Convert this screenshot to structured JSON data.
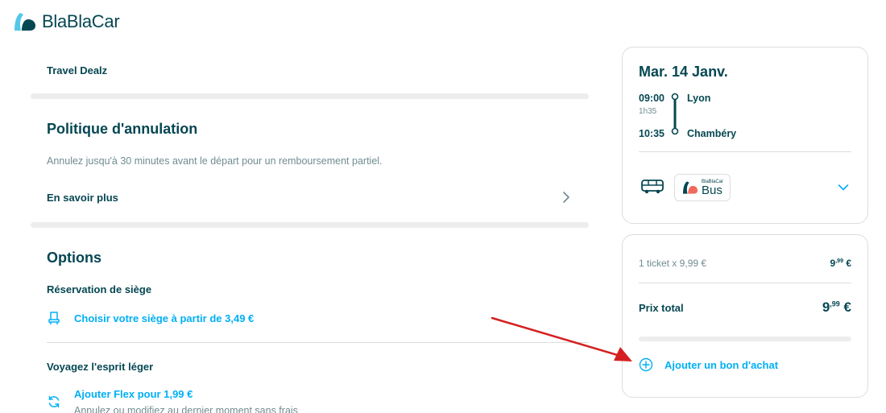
{
  "brand": {
    "name": "BlaBlaCar",
    "logo_color_dark": "#054752",
    "logo_color_light": "#54c8e8"
  },
  "left": {
    "operator_label": "Travel Dealz",
    "cancellation": {
      "title": "Politique d'annulation",
      "description": "Annulez jusqu'à 30 minutes avant le départ pour un remboursement partiel.",
      "learn_more": "En savoir plus"
    },
    "options": {
      "title": "Options",
      "seat_reservation": {
        "title": "Réservation de siège",
        "link": "Choisir votre siège à partir de 3,49 €",
        "icon": "seat-icon"
      },
      "light_travel": {
        "title": "Voyagez l'esprit léger",
        "link": "Ajouter Flex pour 1,99 €",
        "subtitle": "Annulez ou modifiez au dernier moment sans frais",
        "icon": "refresh-icon"
      }
    }
  },
  "trip": {
    "date": "Mar. 14 Janv.",
    "departure_time": "09:00",
    "departure_city": "Lyon",
    "duration": "1h35",
    "arrival_time": "10:35",
    "arrival_city": "Chambéry",
    "operator_small": "BlaBlaCar",
    "operator_big": "Bus",
    "transport_icon": "bus-icon"
  },
  "price": {
    "ticket_line": "1 ticket x 9,99 €",
    "ticket_int": "9",
    "ticket_dec": ",99",
    "ticket_cur": "€",
    "total_label": "Prix total",
    "total_int": "9",
    "total_dec": ",99",
    "total_cur": "€",
    "coupon_label": "Ajouter un bon d'achat"
  },
  "colors": {
    "accent": "#00aff5",
    "text": "#054752",
    "muted": "#708c91",
    "arrow": "#d42020"
  }
}
